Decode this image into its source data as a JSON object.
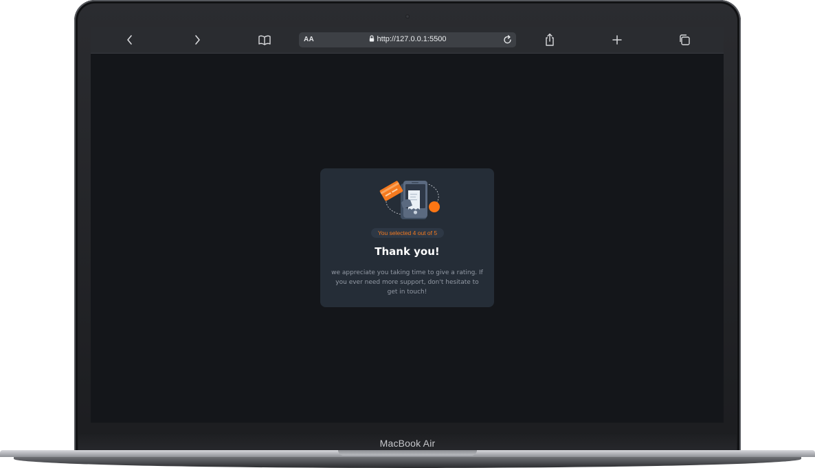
{
  "device": {
    "label": "MacBook Air"
  },
  "browser": {
    "text_size_label": "AA",
    "url": "http://127.0.0.1:5500",
    "icons": [
      "back-icon",
      "forward-icon",
      "bookmarks-icon",
      "lock-icon",
      "reload-icon",
      "share-icon",
      "new-tab-icon",
      "tabs-icon"
    ]
  },
  "card": {
    "illustration": "phone-receipt-card-illustration",
    "selection_text": "You selected 4 out of 5",
    "title": "Thank you!",
    "message": "we appreciate you taking time to give a rating. If you ever need more support, don't hesitate to get in touch!"
  },
  "colors": {
    "page_background": "#14161a",
    "card_background": "#252d37",
    "accent": "#f57a1f",
    "title": "#ffffff",
    "message": "#939aa5"
  }
}
